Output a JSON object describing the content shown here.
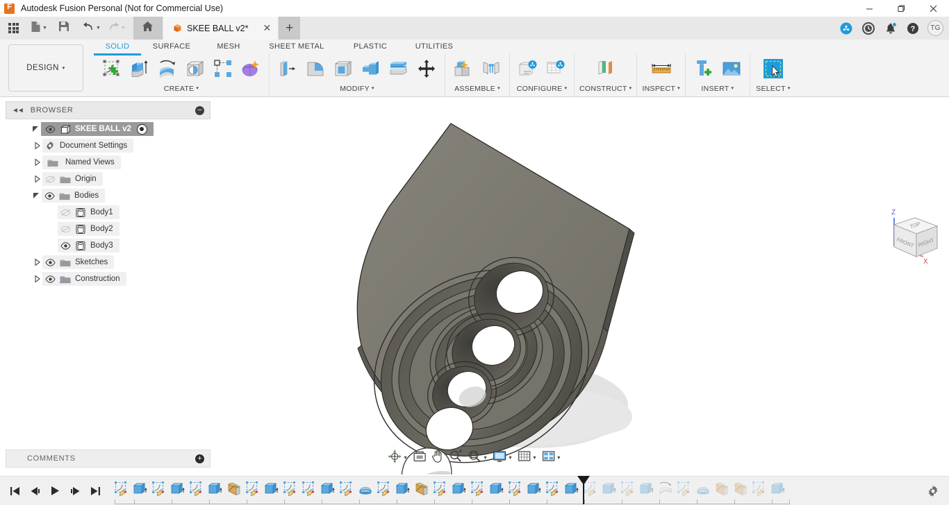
{
  "window": {
    "title": "Autodesk Fusion Personal (Not for Commercial Use)",
    "app_icon": "fusion-logo-icon",
    "minimize": "—",
    "maximize": "❐",
    "close": "✕"
  },
  "quick_access": {
    "items": [
      {
        "name": "app-grid-button",
        "icon": "grid-icon"
      },
      {
        "name": "new-document-button",
        "icon": "file-icon",
        "caret": true
      },
      {
        "name": "save-button",
        "icon": "save-icon"
      },
      {
        "name": "undo-button",
        "icon": "undo-arrow-icon",
        "caret": true
      },
      {
        "name": "redo-button",
        "icon": "redo-arrow-icon",
        "caret": true
      },
      {
        "name": "home-button",
        "icon": "home-icon"
      }
    ]
  },
  "document_tab": {
    "label": "SKEE BALL v2*",
    "icon": "orange-cube-icon",
    "close": "✕",
    "new_tab": "+"
  },
  "tab_right_icons": [
    {
      "name": "extensions-icon",
      "glyph": "extensions"
    },
    {
      "name": "job-status-clock-icon",
      "glyph": "clock"
    },
    {
      "name": "notifications-bell-icon",
      "glyph": "bell",
      "badge": true
    },
    {
      "name": "help-icon",
      "glyph": "help"
    }
  ],
  "account": {
    "initials": "TG"
  },
  "ribbon": {
    "workspace": {
      "label": "DESIGN",
      "caret": "▾"
    },
    "tabs": [
      {
        "label": "SOLID",
        "active": true
      },
      {
        "label": "SURFACE",
        "active": false
      },
      {
        "label": "MESH",
        "active": false
      },
      {
        "label": "SHEET METAL",
        "active": false
      },
      {
        "label": "PLASTIC",
        "active": false
      },
      {
        "label": "UTILITIES",
        "active": false
      }
    ],
    "panels": [
      {
        "label": "CREATE",
        "caret": "▾",
        "tools": [
          {
            "name": "create-sketch-tool",
            "icon": "create-sketch-icon"
          },
          {
            "name": "extrude-tool",
            "icon": "extrude-icon"
          },
          {
            "name": "revolve-tool",
            "icon": "revolve-icon"
          },
          {
            "name": "hole-tool",
            "icon": "hole-icon"
          },
          {
            "name": "pattern-tool",
            "icon": "rectangular-pattern-icon"
          },
          {
            "name": "create-form-tool",
            "icon": "create-form-icon"
          }
        ]
      },
      {
        "label": "MODIFY",
        "caret": "▾",
        "tools": [
          {
            "name": "press-pull-tool",
            "icon": "press-pull-icon"
          },
          {
            "name": "fillet-tool",
            "icon": "fillet-icon"
          },
          {
            "name": "shell-tool",
            "icon": "shell-icon"
          },
          {
            "name": "combine-tool",
            "icon": "combine-icon"
          },
          {
            "name": "offset-face-tool",
            "icon": "offset-face-icon"
          },
          {
            "name": "move-copy-tool",
            "icon": "move-copy-icon"
          }
        ]
      },
      {
        "label": "ASSEMBLE",
        "caret": "▾",
        "tools": [
          {
            "name": "new-component-tool",
            "icon": "new-component-icon"
          },
          {
            "name": "joint-tool",
            "icon": "joint-icon"
          }
        ]
      },
      {
        "label": "CONFIGURE",
        "caret": "▾",
        "tools": [
          {
            "name": "configure-design-tool",
            "icon": "configure-design-icon"
          },
          {
            "name": "configure-table-tool",
            "icon": "configure-table-icon"
          }
        ]
      },
      {
        "label": "CONSTRUCT",
        "caret": "▾",
        "tools": [
          {
            "name": "offset-plane-tool",
            "icon": "offset-plane-icon"
          }
        ]
      },
      {
        "label": "INSPECT",
        "caret": "▾",
        "tools": [
          {
            "name": "measure-tool",
            "icon": "measure-ruler-icon"
          }
        ]
      },
      {
        "label": "INSERT",
        "caret": "▾",
        "tools": [
          {
            "name": "insert-mcmaster-part-tool",
            "icon": "bolt-plus-icon"
          },
          {
            "name": "insert-canvas-tool",
            "icon": "image-icon"
          }
        ]
      },
      {
        "label": "SELECT",
        "caret": "▾",
        "tools": [
          {
            "name": "select-tool",
            "icon": "select-window-cursor-icon"
          }
        ]
      }
    ]
  },
  "browser": {
    "title": "BROWSER",
    "collapse_icon": "double-chevron-left-icon",
    "minimize_icon": "minus-circle-icon",
    "tree": [
      {
        "label": "SKEE BALL v2",
        "depth": 0,
        "expander": "expanded",
        "eye": "visible",
        "icon": "component-cube-icon",
        "root": true,
        "activate_dot": true
      },
      {
        "label": "Document Settings",
        "depth": 1,
        "expander": "collapsed",
        "eye": "none",
        "icon": "gear-icon"
      },
      {
        "label": "Named Views",
        "depth": 1,
        "expander": "collapsed",
        "eye": "none",
        "icon": "folder-icon"
      },
      {
        "label": "Origin",
        "depth": 1,
        "expander": "collapsed",
        "eye": "hidden",
        "icon": "folder-icon"
      },
      {
        "label": "Bodies",
        "depth": 1,
        "expander": "expanded",
        "eye": "visible",
        "icon": "folder-icon"
      },
      {
        "label": "Body1",
        "depth": 2,
        "expander": "none",
        "eye": "hidden",
        "icon": "body-icon"
      },
      {
        "label": "Body2",
        "depth": 2,
        "expander": "none",
        "eye": "hidden",
        "icon": "body-icon"
      },
      {
        "label": "Body3",
        "depth": 2,
        "expander": "none",
        "eye": "visible",
        "icon": "body-icon"
      },
      {
        "label": "Sketches",
        "depth": 1,
        "expander": "collapsed",
        "eye": "visible",
        "icon": "folder-icon"
      },
      {
        "label": "Construction",
        "depth": 1,
        "expander": "collapsed",
        "eye": "visible",
        "icon": "construction-folder-icon"
      }
    ]
  },
  "comments": {
    "title": "COMMENTS",
    "add_icon": "plus-circle-icon"
  },
  "viewcube": {
    "top_face": "TOP",
    "front_face": "FRONT",
    "right_face": "RIGHT",
    "axis_z": "Z",
    "axis_x": "X"
  },
  "navbar": {
    "items": [
      {
        "name": "orbit-tool",
        "icon": "orbit-icon",
        "caret": true
      },
      {
        "name": "look-at-tool",
        "icon": "look-at-icon",
        "caret": false
      },
      {
        "name": "pan-tool",
        "icon": "pan-hand-icon",
        "caret": false
      },
      {
        "name": "zoom-tool",
        "icon": "zoom-magnifier-icon",
        "caret": false
      },
      {
        "name": "fit-tool",
        "icon": "zoom-fit-icon",
        "caret": true
      },
      {
        "name": "display-settings-tool",
        "icon": "display-monitor-icon",
        "caret": true
      },
      {
        "name": "grid-snaps-tool",
        "icon": "grid-icon",
        "caret": true
      },
      {
        "name": "viewport-layout-tool",
        "icon": "viewport-layout-icon",
        "caret": true
      }
    ]
  },
  "timeline": {
    "playback": [
      {
        "name": "timeline-go-to-beginning-button",
        "icon": "skip-start-icon"
      },
      {
        "name": "timeline-step-back-button",
        "icon": "step-back-icon"
      },
      {
        "name": "timeline-play-button",
        "icon": "play-icon"
      },
      {
        "name": "timeline-step-forward-button",
        "icon": "step-forward-icon"
      },
      {
        "name": "timeline-go-to-end-button",
        "icon": "skip-end-icon"
      }
    ],
    "features": [
      {
        "type": "sketch",
        "dim": false
      },
      {
        "type": "extrude",
        "dim": false
      },
      {
        "type": "sketch",
        "dim": false
      },
      {
        "type": "extrude",
        "dim": false
      },
      {
        "type": "sketch",
        "dim": false
      },
      {
        "type": "extrude",
        "dim": false
      },
      {
        "type": "plane",
        "dim": false
      },
      {
        "type": "sketch",
        "dim": false
      },
      {
        "type": "extrude",
        "dim": false
      },
      {
        "type": "sketch",
        "dim": false
      },
      {
        "type": "sketch",
        "dim": false
      },
      {
        "type": "extrude",
        "dim": false
      },
      {
        "type": "sketch",
        "dim": false
      },
      {
        "type": "loft",
        "dim": false
      },
      {
        "type": "sketch",
        "dim": false
      },
      {
        "type": "extrude",
        "dim": false
      },
      {
        "type": "plane",
        "dim": false
      },
      {
        "type": "sketch",
        "dim": false
      },
      {
        "type": "extrude",
        "dim": false
      },
      {
        "type": "sketch",
        "dim": false
      },
      {
        "type": "extrude",
        "dim": false
      },
      {
        "type": "sketch",
        "dim": false
      },
      {
        "type": "extrude",
        "dim": false
      },
      {
        "type": "sketch",
        "dim": false
      },
      {
        "type": "extrude",
        "dim": false
      },
      {
        "type": "sketch",
        "dim": true
      },
      {
        "type": "extrude",
        "dim": true
      },
      {
        "type": "sketch",
        "dim": true
      },
      {
        "type": "extrude",
        "dim": true
      },
      {
        "type": "revolve",
        "dim": true
      },
      {
        "type": "sketch",
        "dim": true
      },
      {
        "type": "loft",
        "dim": true
      },
      {
        "type": "plane",
        "dim": true
      },
      {
        "type": "plane",
        "dim": true
      },
      {
        "type": "sketch",
        "dim": true
      },
      {
        "type": "extrude",
        "dim": true
      }
    ],
    "marker_index": 25,
    "settings_icon": "gear-icon"
  },
  "colors": {
    "accent_blue": "#1d9bdd",
    "brand_orange": "#e8721c",
    "model_surface": "#7d7a70",
    "model_surface_dark": "#4c4a44",
    "shadow": "#d2d2d2",
    "canvas_bg": "#ffffff",
    "ribbon_bg": "#f3f3f3"
  }
}
